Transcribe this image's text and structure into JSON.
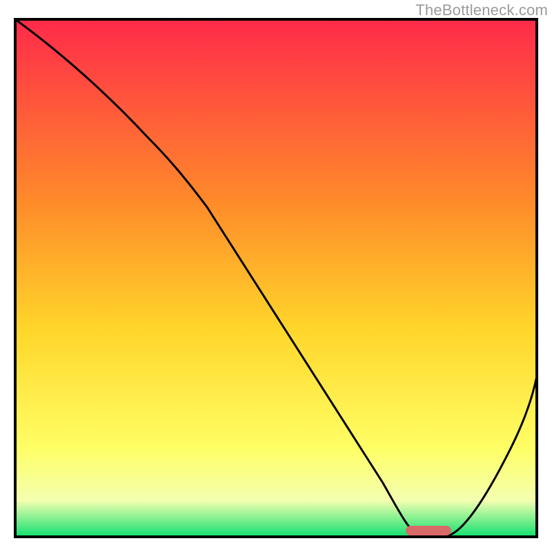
{
  "watermark": "TheBottleneck.com",
  "colors": {
    "grad_top": "#ff2a4a",
    "grad_mid1": "#ff8a2a",
    "grad_mid2": "#ffd62a",
    "grad_mid3": "#ffff66",
    "grad_bottom": "#10e070",
    "curve": "#000000",
    "marker": "#d96a6a",
    "frame": "#000000"
  },
  "chart_data": {
    "type": "line",
    "title": "",
    "xlabel": "",
    "ylabel": "",
    "xlim": [
      0,
      100
    ],
    "ylim": [
      0,
      100
    ],
    "x": [
      0,
      6,
      12,
      18,
      24,
      30,
      36,
      42,
      48,
      54,
      60,
      66,
      70,
      74,
      78,
      82,
      86,
      90,
      94,
      98,
      100
    ],
    "y": [
      100,
      95,
      90,
      85,
      80,
      74,
      66,
      58,
      50,
      42,
      34,
      22,
      12,
      4,
      0,
      0,
      2,
      8,
      16,
      26,
      32
    ],
    "marker": {
      "x_start": 72,
      "x_end": 82,
      "y": 1.5
    },
    "notes": "Curve descends from top-left, dips to zero near x≈76–80, rises again toward right edge. Marker is a short rounded bar on x-axis at the minimum."
  }
}
